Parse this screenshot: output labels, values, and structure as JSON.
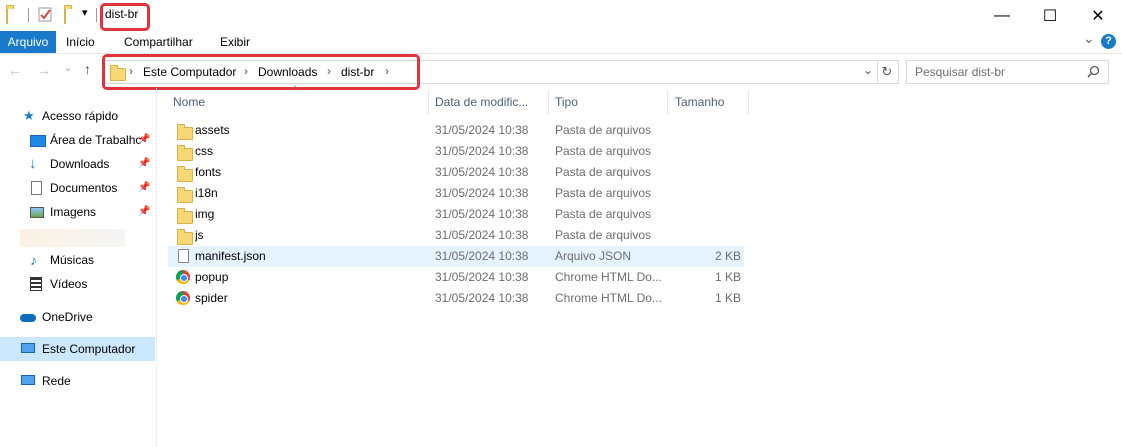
{
  "window": {
    "title": "dist-br",
    "minimize": "—",
    "maximize": "☐",
    "close": "✕"
  },
  "ribbon": {
    "tabs": [
      "Arquivo",
      "Início",
      "Compartilhar",
      "Exibir"
    ],
    "expand": "⌄",
    "help": "?"
  },
  "address": {
    "crumbs": [
      "Este Computador",
      "Downloads",
      "dist-br"
    ],
    "search_placeholder": "Pesquisar dist-br"
  },
  "sidebar": {
    "quick_access": "Acesso rápido",
    "items": [
      {
        "label": "Área de Trabalhc",
        "pinned": true
      },
      {
        "label": "Downloads",
        "pinned": true
      },
      {
        "label": "Documentos",
        "pinned": true
      },
      {
        "label": "Imagens",
        "pinned": true
      },
      {
        "label": "Músicas",
        "pinned": false
      },
      {
        "label": "Vídeos",
        "pinned": false
      }
    ],
    "onedrive": "OneDrive",
    "this_pc": "Este Computador",
    "network": "Rede"
  },
  "columns": {
    "name": "Nome",
    "date": "Data de modific...",
    "type": "Tipo",
    "size": "Tamanho"
  },
  "files": [
    {
      "name": "assets",
      "date": "31/05/2024 10:38",
      "type": "Pasta de arquivos",
      "size": "",
      "icon": "folder-icon"
    },
    {
      "name": "css",
      "date": "31/05/2024 10:38",
      "type": "Pasta de arquivos",
      "size": "",
      "icon": "folder-icon"
    },
    {
      "name": "fonts",
      "date": "31/05/2024 10:38",
      "type": "Pasta de arquivos",
      "size": "",
      "icon": "folder-icon"
    },
    {
      "name": "i18n",
      "date": "31/05/2024 10:38",
      "type": "Pasta de arquivos",
      "size": "",
      "icon": "folder-icon"
    },
    {
      "name": "img",
      "date": "31/05/2024 10:38",
      "type": "Pasta de arquivos",
      "size": "",
      "icon": "folder-icon"
    },
    {
      "name": "js",
      "date": "31/05/2024 10:38",
      "type": "Pasta de arquivos",
      "size": "",
      "icon": "folder-icon"
    },
    {
      "name": "manifest.json",
      "date": "31/05/2024 10:38",
      "type": "Arquivo JSON",
      "size": "2 KB",
      "icon": "file-icon"
    },
    {
      "name": "popup",
      "date": "31/05/2024 10:38",
      "type": "Chrome HTML Do...",
      "size": "1 KB",
      "icon": "chrome-icon"
    },
    {
      "name": "spider",
      "date": "31/05/2024 10:38",
      "type": "Chrome HTML Do...",
      "size": "1 KB",
      "icon": "chrome-icon"
    }
  ],
  "colors": {
    "accent": "#1979ca",
    "highlight": "#e0343a",
    "selected_row": "#e5f3ff",
    "selected_nav": "#cce8ff"
  }
}
